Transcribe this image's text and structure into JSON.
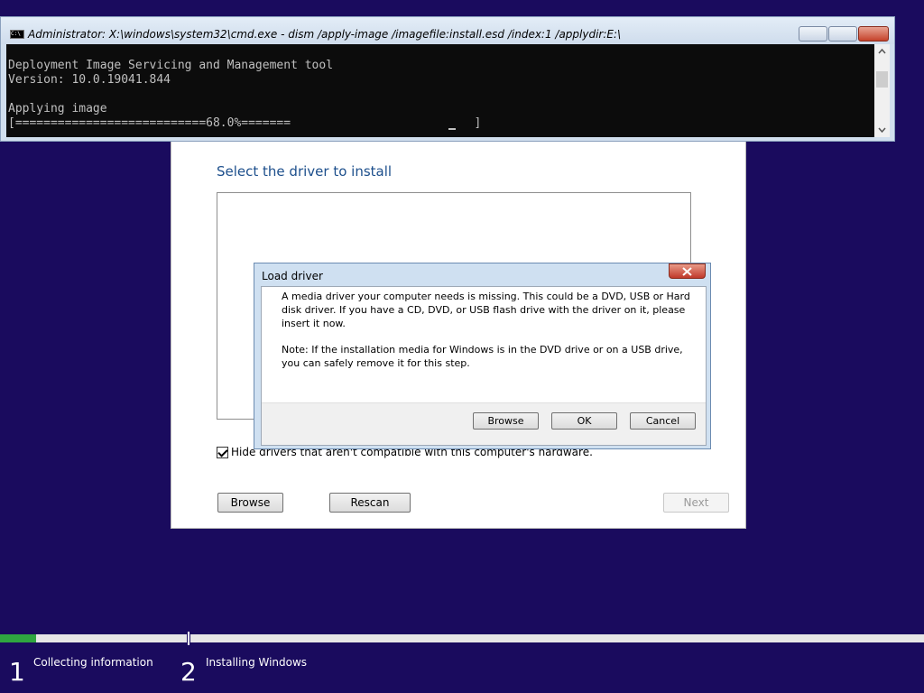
{
  "cmd": {
    "title": "Administrator: X:\\windows\\system32\\cmd.exe - dism  /apply-image /imagefile:install.esd /index:1 /applydir:E:\\",
    "icon": "cmd-icon",
    "lines": [
      "Deployment Image Servicing and Management tool",
      "Version: 10.0.19041.844",
      "",
      "Applying image",
      "[===========================68.0%=======                          ]"
    ],
    "progress_percent": "68.0%"
  },
  "setup": {
    "title": "Select the driver to install",
    "hide_checkbox_label": "Hide drivers that aren't compatible with this computer's hardware.",
    "hide_checked": true,
    "browse_label": "Browse",
    "rescan_label": "Rescan",
    "next_label": "Next"
  },
  "load_driver": {
    "title": "Load driver",
    "message": "A media driver your computer needs is missing. This could be a DVD, USB or Hard disk driver. If you have a CD, DVD, or USB flash drive with the driver on it, please insert it now.",
    "note": "Note: If the installation media for Windows is in the DVD drive or on a USB drive, you can safely remove it for this step.",
    "browse_label": "Browse",
    "ok_label": "OK",
    "cancel_label": "Cancel"
  },
  "steps": [
    {
      "number": "1",
      "label": "Collecting information"
    },
    {
      "number": "2",
      "label": "Installing Windows"
    }
  ],
  "colors": {
    "desktop": "#1a0b5e",
    "progress": "#2fa640",
    "heading": "#1d4f8c"
  }
}
